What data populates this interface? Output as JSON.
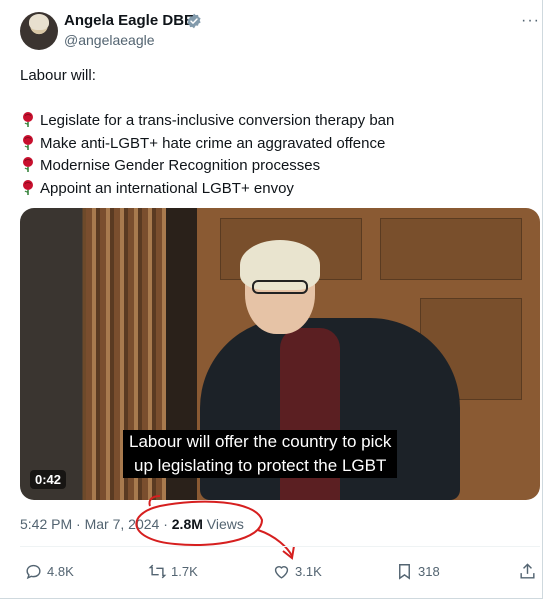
{
  "author": {
    "name": "Angela Eagle DBE",
    "handle": "@angelaeagle",
    "verified_icon": "verified-badge-icon"
  },
  "more_label": "···",
  "tweet": {
    "intro": "Labour will:",
    "points": [
      "Legislate for a trans-inclusive conversion therapy ban",
      "Make anti-LGBT+ hate crime an aggravated offence",
      "Modernise Gender Recognition processes",
      "Appoint an international LGBT+ envoy"
    ],
    "bullet_icon": "rose-icon"
  },
  "video": {
    "caption_line1": "Labour will offer the country to pick",
    "caption_line2": "up legislating to protect the LGBT",
    "duration": "0:42"
  },
  "meta": {
    "time": "5:42 PM",
    "sep": "·",
    "date": "Mar 7, 2024",
    "views_count": "2.8M",
    "views_label": "Views"
  },
  "actions": {
    "replies": "4.8K",
    "reposts": "1.7K",
    "likes": "3.1K",
    "bookmarks": "318"
  },
  "colors": {
    "text": "#0f1419",
    "muted": "#536471",
    "verified": "#829aab",
    "annotation": "#d61f1f"
  }
}
